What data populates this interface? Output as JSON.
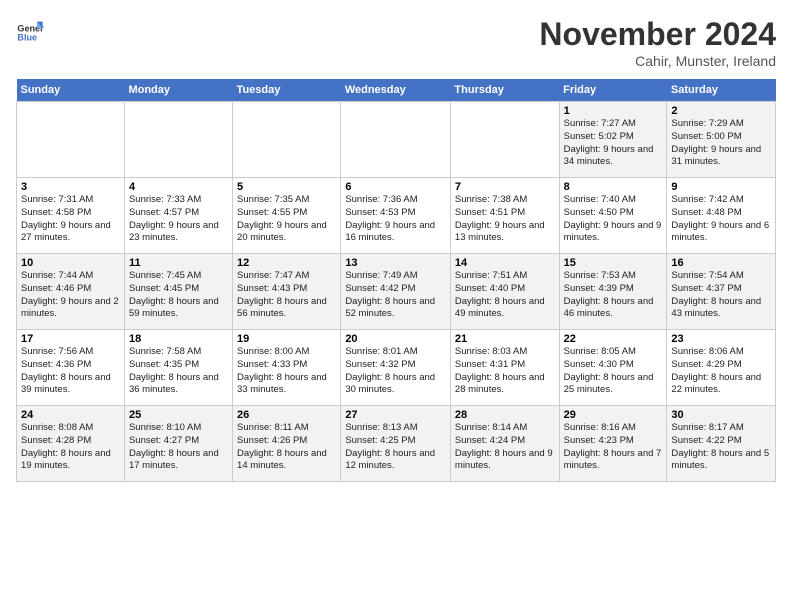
{
  "logo": {
    "line1": "General",
    "line2": "Blue"
  },
  "title": "November 2024",
  "subtitle": "Cahir, Munster, Ireland",
  "days_of_week": [
    "Sunday",
    "Monday",
    "Tuesday",
    "Wednesday",
    "Thursday",
    "Friday",
    "Saturday"
  ],
  "weeks": [
    [
      {
        "day": "",
        "info": ""
      },
      {
        "day": "",
        "info": ""
      },
      {
        "day": "",
        "info": ""
      },
      {
        "day": "",
        "info": ""
      },
      {
        "day": "",
        "info": ""
      },
      {
        "day": "1",
        "info": "Sunrise: 7:27 AM\nSunset: 5:02 PM\nDaylight: 9 hours and 34 minutes."
      },
      {
        "day": "2",
        "info": "Sunrise: 7:29 AM\nSunset: 5:00 PM\nDaylight: 9 hours and 31 minutes."
      }
    ],
    [
      {
        "day": "3",
        "info": "Sunrise: 7:31 AM\nSunset: 4:58 PM\nDaylight: 9 hours and 27 minutes."
      },
      {
        "day": "4",
        "info": "Sunrise: 7:33 AM\nSunset: 4:57 PM\nDaylight: 9 hours and 23 minutes."
      },
      {
        "day": "5",
        "info": "Sunrise: 7:35 AM\nSunset: 4:55 PM\nDaylight: 9 hours and 20 minutes."
      },
      {
        "day": "6",
        "info": "Sunrise: 7:36 AM\nSunset: 4:53 PM\nDaylight: 9 hours and 16 minutes."
      },
      {
        "day": "7",
        "info": "Sunrise: 7:38 AM\nSunset: 4:51 PM\nDaylight: 9 hours and 13 minutes."
      },
      {
        "day": "8",
        "info": "Sunrise: 7:40 AM\nSunset: 4:50 PM\nDaylight: 9 hours and 9 minutes."
      },
      {
        "day": "9",
        "info": "Sunrise: 7:42 AM\nSunset: 4:48 PM\nDaylight: 9 hours and 6 minutes."
      }
    ],
    [
      {
        "day": "10",
        "info": "Sunrise: 7:44 AM\nSunset: 4:46 PM\nDaylight: 9 hours and 2 minutes."
      },
      {
        "day": "11",
        "info": "Sunrise: 7:45 AM\nSunset: 4:45 PM\nDaylight: 8 hours and 59 minutes."
      },
      {
        "day": "12",
        "info": "Sunrise: 7:47 AM\nSunset: 4:43 PM\nDaylight: 8 hours and 56 minutes."
      },
      {
        "day": "13",
        "info": "Sunrise: 7:49 AM\nSunset: 4:42 PM\nDaylight: 8 hours and 52 minutes."
      },
      {
        "day": "14",
        "info": "Sunrise: 7:51 AM\nSunset: 4:40 PM\nDaylight: 8 hours and 49 minutes."
      },
      {
        "day": "15",
        "info": "Sunrise: 7:53 AM\nSunset: 4:39 PM\nDaylight: 8 hours and 46 minutes."
      },
      {
        "day": "16",
        "info": "Sunrise: 7:54 AM\nSunset: 4:37 PM\nDaylight: 8 hours and 43 minutes."
      }
    ],
    [
      {
        "day": "17",
        "info": "Sunrise: 7:56 AM\nSunset: 4:36 PM\nDaylight: 8 hours and 39 minutes."
      },
      {
        "day": "18",
        "info": "Sunrise: 7:58 AM\nSunset: 4:35 PM\nDaylight: 8 hours and 36 minutes."
      },
      {
        "day": "19",
        "info": "Sunrise: 8:00 AM\nSunset: 4:33 PM\nDaylight: 8 hours and 33 minutes."
      },
      {
        "day": "20",
        "info": "Sunrise: 8:01 AM\nSunset: 4:32 PM\nDaylight: 8 hours and 30 minutes."
      },
      {
        "day": "21",
        "info": "Sunrise: 8:03 AM\nSunset: 4:31 PM\nDaylight: 8 hours and 28 minutes."
      },
      {
        "day": "22",
        "info": "Sunrise: 8:05 AM\nSunset: 4:30 PM\nDaylight: 8 hours and 25 minutes."
      },
      {
        "day": "23",
        "info": "Sunrise: 8:06 AM\nSunset: 4:29 PM\nDaylight: 8 hours and 22 minutes."
      }
    ],
    [
      {
        "day": "24",
        "info": "Sunrise: 8:08 AM\nSunset: 4:28 PM\nDaylight: 8 hours and 19 minutes."
      },
      {
        "day": "25",
        "info": "Sunrise: 8:10 AM\nSunset: 4:27 PM\nDaylight: 8 hours and 17 minutes."
      },
      {
        "day": "26",
        "info": "Sunrise: 8:11 AM\nSunset: 4:26 PM\nDaylight: 8 hours and 14 minutes."
      },
      {
        "day": "27",
        "info": "Sunrise: 8:13 AM\nSunset: 4:25 PM\nDaylight: 8 hours and 12 minutes."
      },
      {
        "day": "28",
        "info": "Sunrise: 8:14 AM\nSunset: 4:24 PM\nDaylight: 8 hours and 9 minutes."
      },
      {
        "day": "29",
        "info": "Sunrise: 8:16 AM\nSunset: 4:23 PM\nDaylight: 8 hours and 7 minutes."
      },
      {
        "day": "30",
        "info": "Sunrise: 8:17 AM\nSunset: 4:22 PM\nDaylight: 8 hours and 5 minutes."
      }
    ]
  ]
}
